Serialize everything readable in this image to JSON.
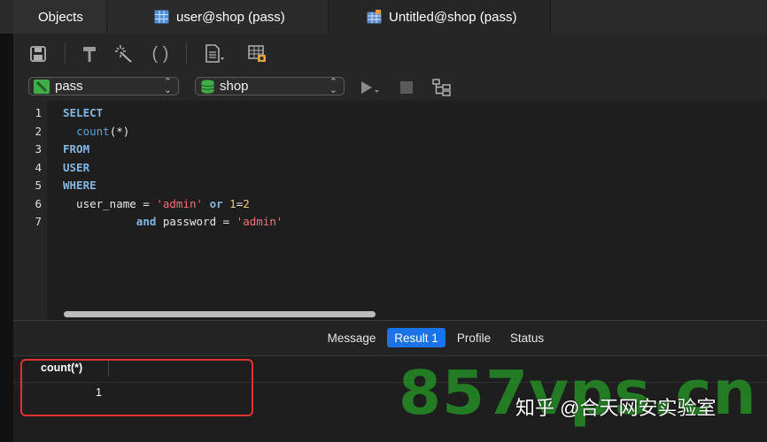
{
  "tabs": [
    {
      "label": "Objects"
    },
    {
      "label": "user@shop (pass)",
      "icon": "table-icon"
    },
    {
      "label": "Untitled@shop (pass)",
      "icon": "query-table-icon"
    }
  ],
  "toolbar": {
    "icons": [
      "save-icon",
      "build-hammer-icon",
      "beautify-wand-icon",
      "parentheses-icon",
      "code-snippet-icon",
      "explain-table-icon"
    ]
  },
  "selectors": {
    "connection": "pass",
    "database": "shop"
  },
  "editor": {
    "line_numbers": [
      "1",
      "2",
      "3",
      "4",
      "5",
      "6",
      "7"
    ],
    "lines": [
      {
        "p1": "SELECT"
      },
      {
        "p0": "  ",
        "p1": "count",
        "p2": "(*)"
      },
      {
        "p1": "FROM"
      },
      {
        "p1": "USER"
      },
      {
        "p1": "WHERE"
      },
      {
        "p0": "  user_name = ",
        "p1": "'admin'",
        "p2": " ",
        "p3": "or",
        "p4": " ",
        "p5": "1",
        "p6": "=",
        "p7": "2"
      },
      {
        "p0": "           ",
        "p1": "and",
        "p2": " password = ",
        "p3": "'admin'"
      }
    ]
  },
  "result_tabs": [
    "Message",
    "Result 1",
    "Profile",
    "Status"
  ],
  "active_result_tab": "Result 1",
  "grid": {
    "column": "count(*)",
    "rows": [
      [
        "1"
      ]
    ]
  },
  "watermark": {
    "big": "857vps.cn",
    "small": "知乎 @合天网安实验室"
  },
  "colors": {
    "accent": "#1a73e8",
    "highlight_box": "#e0332f",
    "watermark_green": "#26a026"
  }
}
